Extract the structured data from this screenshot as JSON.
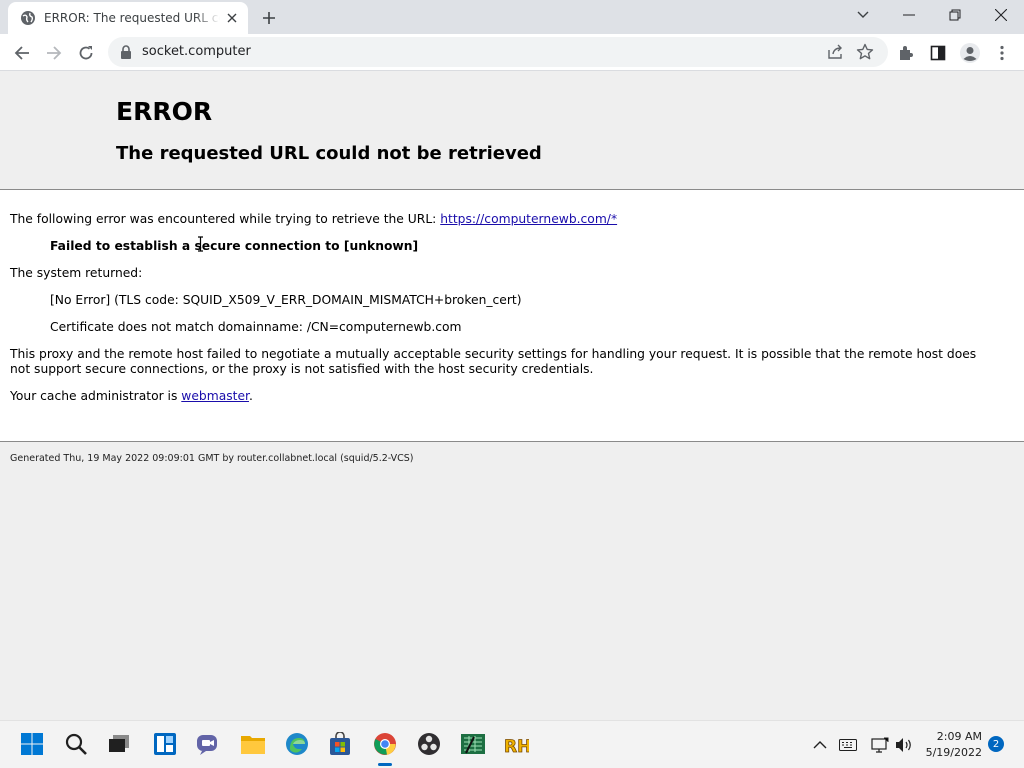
{
  "browser": {
    "tab_title": "ERROR: The requested URL could not be retrieved",
    "url": "socket.computer"
  },
  "page": {
    "heading": "ERROR",
    "subheading": "The requested URL could not be retrieved",
    "intro_text": "The following error was encountered while trying to retrieve the URL: ",
    "intro_link": "https://computernewb.com/*",
    "error_title": "Failed to establish a secure connection to [unknown]",
    "system_returned": "The system returned:",
    "system_error": "[No Error] (TLS code: SQUID_X509_V_ERR_DOMAIN_MISMATCH+broken_cert)",
    "cert_message": "Certificate does not match domainname: /CN=computernewb.com",
    "explanation": "This proxy and the remote host failed to negotiate a mutually acceptable security settings for handling your request. It is possible that the remote host does not support secure connections, or the proxy is not satisfied with the host security credentials.",
    "admin_text": "Your cache administrator is ",
    "admin_link": "webmaster",
    "admin_suffix": ".",
    "generated": "Generated Thu, 19 May 2022 09:09:01 GMT by router.collabnet.local (squid/5.2-VCS)"
  },
  "taskbar": {
    "time": "2:09 AM",
    "date": "5/19/2022",
    "notification_count": "2"
  },
  "colors": {
    "link": "#1a0dab",
    "accent": "#0067c0"
  }
}
